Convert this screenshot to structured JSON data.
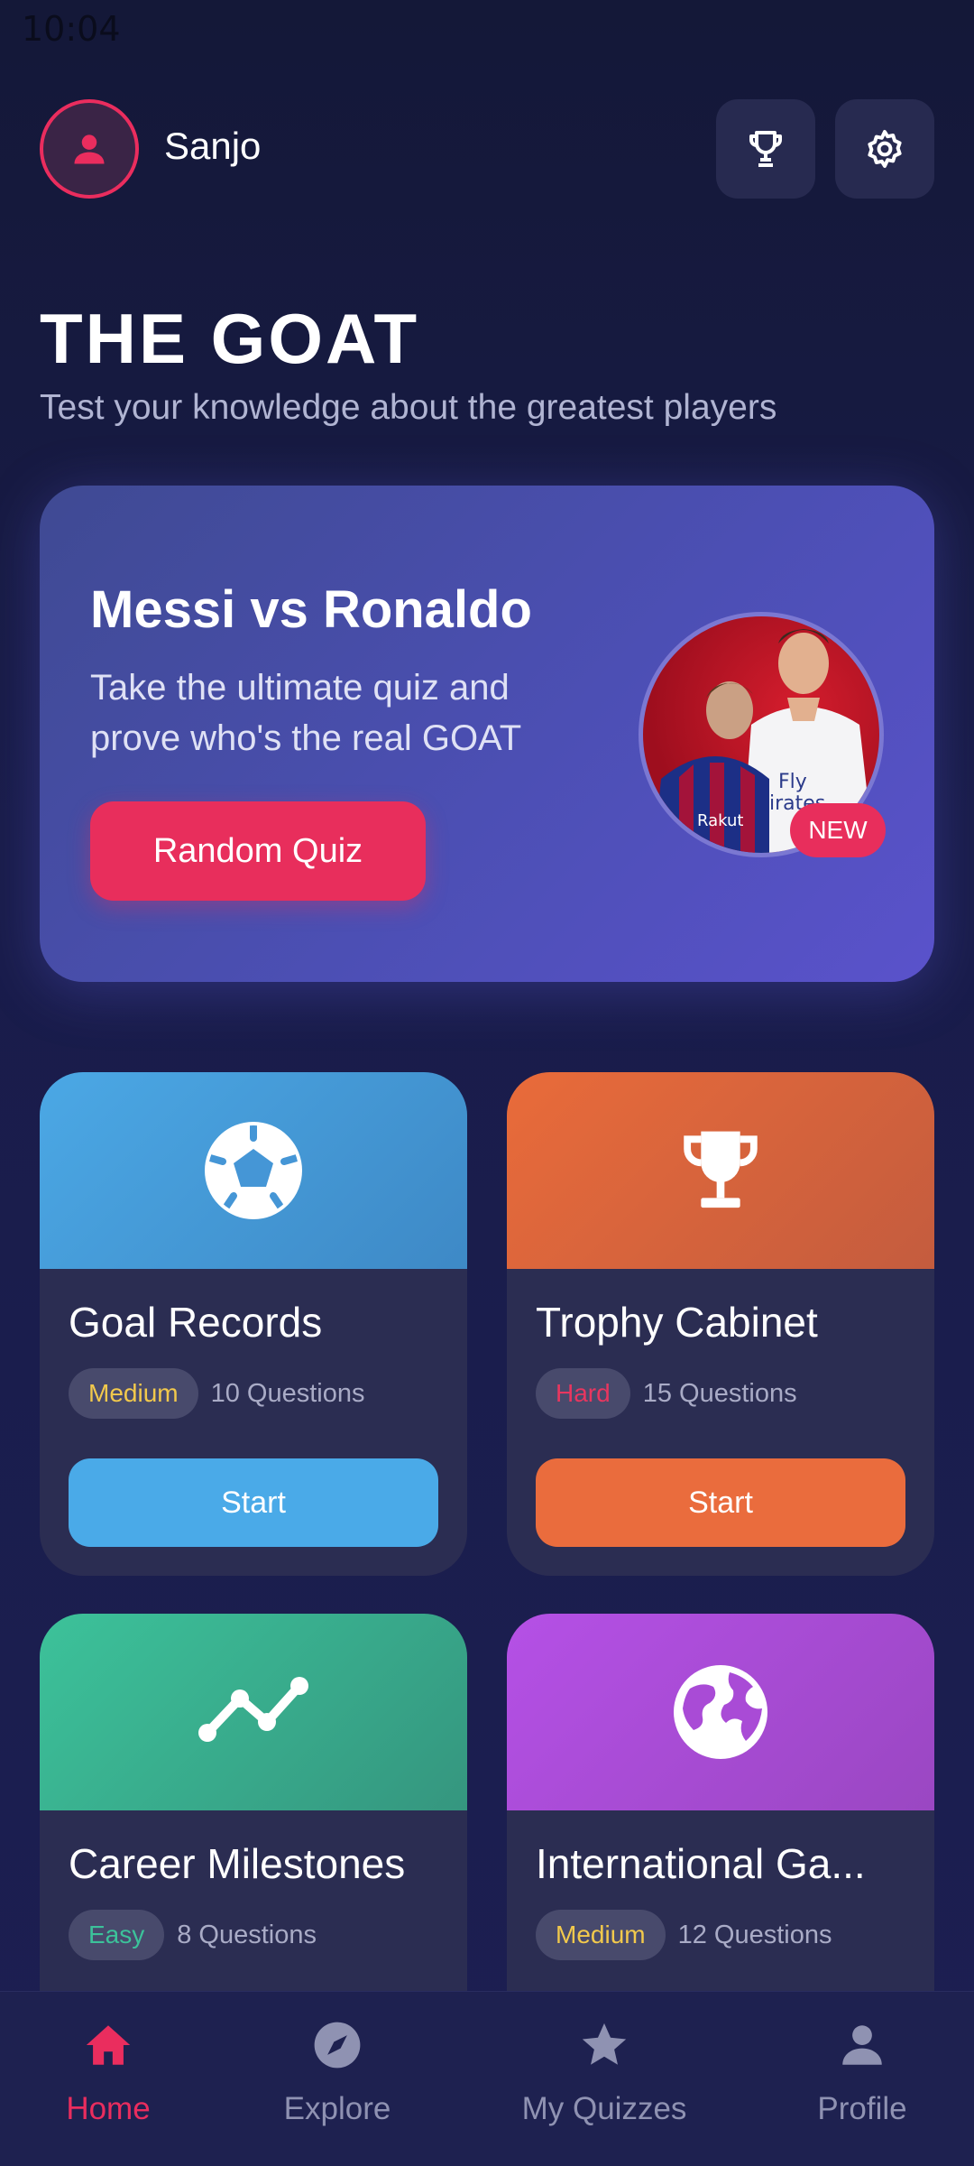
{
  "status_bar": {
    "time": "10:04"
  },
  "header": {
    "username": "Sanjo"
  },
  "page": {
    "title": "THE GOAT",
    "subtitle": "Test your knowledge about the greatest players"
  },
  "hero": {
    "title": "Messi vs Ronaldo",
    "description": "Take the ultimate quiz and prove who's the real GOAT",
    "button_label": "Random Quiz",
    "badge": "NEW",
    "image_subject": "Messi and Ronaldo photo"
  },
  "quizzes": [
    {
      "title": "Goal Records",
      "difficulty": "Medium",
      "questions": "10 Questions",
      "start_label": "Start",
      "icon": "soccer-ball-icon",
      "color": "#4aaae8",
      "difficulty_color": "#f2c94c"
    },
    {
      "title": "Trophy Cabinet",
      "difficulty": "Hard",
      "questions": "15 Questions",
      "start_label": "Start",
      "icon": "trophy-icon",
      "color": "#ea6c3d",
      "difficulty_color": "#e8365f"
    },
    {
      "title": "Career Milestones",
      "difficulty": "Easy",
      "questions": "8 Questions",
      "start_label": "",
      "icon": "chart-line-icon",
      "color": "#3cc29a",
      "difficulty_color": "#3cc29a"
    },
    {
      "title": "International Ga...",
      "difficulty": "Medium",
      "questions": "12 Questions",
      "start_label": "",
      "icon": "globe-icon",
      "color": "#b550e6",
      "difficulty_color": "#f2c94c"
    }
  ],
  "bottom_nav": {
    "items": [
      {
        "label": "Home",
        "icon": "home-icon",
        "active": true
      },
      {
        "label": "Explore",
        "icon": "compass-icon",
        "active": false
      },
      {
        "label": "My Quizzes",
        "icon": "star-icon",
        "active": false
      },
      {
        "label": "Profile",
        "icon": "person-icon",
        "active": false
      }
    ]
  },
  "colors": {
    "accent": "#e82e5c",
    "background": "#171a45",
    "hero_gradient": [
      "#3f4a93",
      "#5a52cb"
    ]
  }
}
